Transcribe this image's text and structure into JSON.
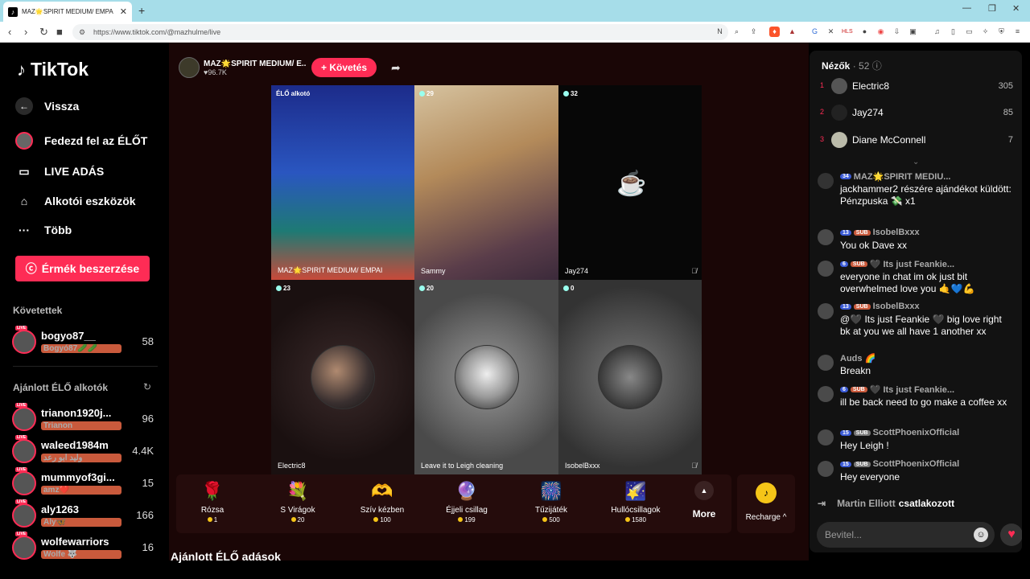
{
  "browser": {
    "tab_title": "MAZ🌟SPIRIT MEDIUM/ EMPA",
    "new_tab": "+",
    "url": "https://www.tiktok.com/@mazhulme/live"
  },
  "sidebar": {
    "logo": "TikTok",
    "back": "Vissza",
    "nav": [
      {
        "label": "Fedezd fel az ÉLŐT",
        "icon": "avatar"
      },
      {
        "label": "LIVE ADÁS",
        "icon": "video-icon"
      },
      {
        "label": "Alkotói eszközök",
        "icon": "house-plus-icon"
      },
      {
        "label": "Több",
        "icon": "more-icon"
      }
    ],
    "coins_button": "Érmék beszerzése",
    "followed_title": "Követettek",
    "followed": [
      {
        "name": "bogyo87__",
        "sub": "Bogyó87🥒🥒",
        "count": "58",
        "live": "LIVE"
      }
    ],
    "recommended_title": "Ajánlott ÉLŐ alkotók",
    "recommended": [
      {
        "name": "trianon1920j...",
        "sub": "Trianon",
        "count": "96",
        "live": "LIVE"
      },
      {
        "name": "waleed1984m",
        "sub": "وليد ابو رعد",
        "count": "4.4K",
        "live": "LIVE"
      },
      {
        "name": "mummyof3gi...",
        "sub": "amz❤️",
        "count": "15",
        "live": "LIVE"
      },
      {
        "name": "aly1263",
        "sub": "Aly🦋",
        "count": "166",
        "live": "LIVE"
      },
      {
        "name": "wolfewarriors",
        "sub": "Wolfe 🐺",
        "count": "16",
        "live": "LIVE"
      }
    ]
  },
  "stream": {
    "host_name": "MAZ🌟SPIRIT MEDIUM/ E...",
    "likes": "♥96.7K",
    "follow_label": "+ Követés",
    "tiles": [
      {
        "badge": "ÉLŐ alkotó",
        "name": "MAZ🌟SPIRIT MEDIUM/ EMPAI",
        "muted": false
      },
      {
        "badge": "29",
        "name": "Sammy",
        "muted": false
      },
      {
        "badge": "32",
        "name": "Jay274",
        "muted": true
      },
      {
        "badge": "23",
        "name": "Electric8",
        "muted": false
      },
      {
        "badge": "20",
        "name": "Leave it to Leigh cleaning",
        "muted": false
      },
      {
        "badge": "0",
        "name": "IsobelBxxx",
        "muted": true
      }
    ],
    "gifts": [
      {
        "name": "Rózsa",
        "price": "1",
        "icon": "🌹"
      },
      {
        "name": "S Virágok",
        "price": "20",
        "icon": "💐"
      },
      {
        "name": "Szív kézben",
        "price": "100",
        "icon": "🫶"
      },
      {
        "name": "Éjjeli csillag",
        "price": "199",
        "icon": "🔮"
      },
      {
        "name": "Tűzijáték",
        "price": "500",
        "icon": "🎆"
      },
      {
        "name": "Hullócsillagok",
        "price": "1580",
        "icon": "🌠"
      }
    ],
    "more_label": "More",
    "recharge_label": "Recharge ^",
    "recommended_live": "Ajánlott ÉLŐ adások"
  },
  "panel": {
    "viewers_title": "Nézők",
    "viewers_count": "· 52",
    "top_viewers": [
      {
        "rank": "1",
        "name": "Electric8",
        "score": "305"
      },
      {
        "rank": "2",
        "name": "Jay274",
        "score": "85"
      },
      {
        "rank": "3",
        "name": "Diane McConnell",
        "score": "7"
      }
    ],
    "chat": [
      {
        "level": "34",
        "user": "MAZ🌟SPIRIT MEDIU...",
        "body": "jackhammer2 részére ajándékot küldött: Pénzpuska 💸 x1"
      },
      {
        "level": "13",
        "sub": "SUB",
        "user": "IsobelBxxx",
        "body": "You ok Dave xx"
      },
      {
        "level": "6",
        "sub": "SUB",
        "user": "🖤 Its just Feankie...",
        "body": "everyone in chat im ok just bit overwhelmed love you 🤙💙💪"
      },
      {
        "level": "13",
        "sub": "SUB",
        "user": "IsobelBxxx",
        "body": "@🖤 Its just Feankie 🖤 big love right bk at you we all have 1 another xx"
      },
      {
        "user": "Auds 🌈",
        "body": "Breakn"
      },
      {
        "level": "6",
        "sub": "SUB",
        "user": "🖤 Its just Feankie...",
        "body": "ill be back need to go make a coffee xx"
      },
      {
        "level": "15",
        "sub": "SUB",
        "user": "ScottPhoenixOfficial",
        "body": "Hey Leigh !"
      },
      {
        "level": "15",
        "sub": "SUB",
        "user": "ScottPhoenixOfficial",
        "body": "Hey everyone"
      }
    ],
    "joined_user": "Martin Elliott",
    "joined_text": "csatlakozott",
    "input_placeholder": "Bevitel..."
  }
}
